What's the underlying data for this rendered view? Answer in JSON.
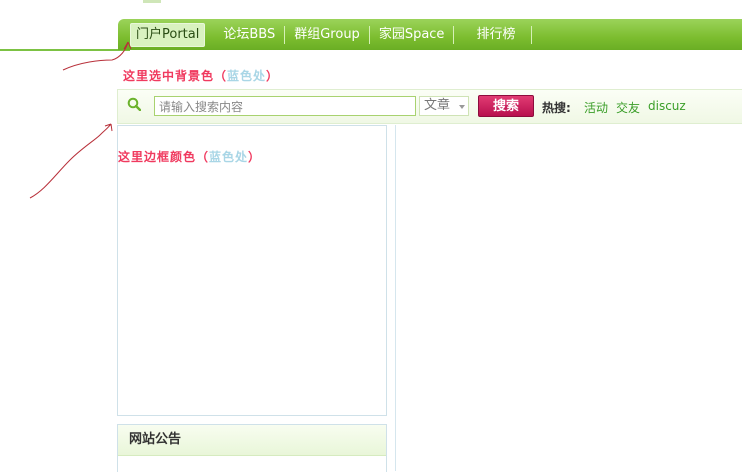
{
  "nav": {
    "items": [
      {
        "label": "门户Portal",
        "active": true
      },
      {
        "label": "论坛BBS"
      },
      {
        "label": "群组Group"
      },
      {
        "label": "家园Space"
      },
      {
        "label": "排行榜"
      }
    ]
  },
  "annotations": {
    "selected_bg": {
      "prefix": "这里选中背景色（",
      "blue": "蓝色处",
      "suffix": "）"
    },
    "border_color": {
      "prefix": "这里边框颜色（",
      "blue": "蓝色处",
      "suffix": "）"
    }
  },
  "search": {
    "placeholder": "请输入搜索内容",
    "category": "文章",
    "button": "搜索",
    "hot_label": "热搜:",
    "hot_links": [
      "活动",
      "交友",
      "discuz"
    ]
  },
  "notice": {
    "title": "网站公告"
  },
  "colors": {
    "nav_green": "#7cbd2f",
    "annotation_red": "#f03a5f",
    "annotation_blue": "#a9d6e6",
    "search_button": "#c8175a",
    "hot_link": "#3a9e28",
    "panel_border": "#cfe1e9"
  }
}
